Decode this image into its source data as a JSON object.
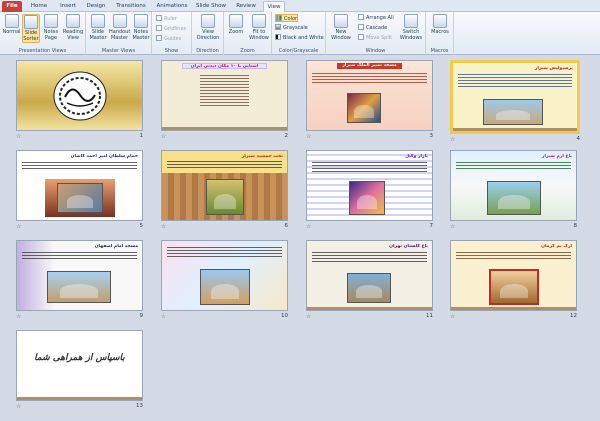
{
  "tabs": [
    "File",
    "Home",
    "Insert",
    "Design",
    "Transitions",
    "Animations",
    "Slide Show",
    "Review",
    "View"
  ],
  "active_tab": "View",
  "ribbon": {
    "presentation_views": {
      "label": "Presentation Views",
      "buttons": [
        "Normal",
        "Slide Sorter",
        "Notes Page",
        "Reading View"
      ]
    },
    "master_views": {
      "label": "Master Views",
      "buttons": [
        "Slide Master",
        "Handout Master",
        "Notes Master"
      ]
    },
    "show": {
      "label": "Show",
      "items": [
        "Ruler",
        "Gridlines",
        "Guides"
      ]
    },
    "direction": {
      "label": "Direction",
      "button": "View Direction"
    },
    "zoom": {
      "label": "Zoom",
      "buttons": [
        "Zoom",
        "Fit to Window"
      ]
    },
    "color_grayscale": {
      "label": "Color/Grayscale",
      "items": [
        "Color",
        "Grayscale",
        "Black and White"
      ]
    },
    "window": {
      "label": "Window",
      "new_window": "New Window",
      "items": [
        "Arrange All",
        "Cascade",
        "Move Split"
      ],
      "switch_windows": "Switch Windows"
    },
    "macros": {
      "label": "Macros",
      "button": "Macros"
    }
  },
  "slides": [
    {
      "number": "1",
      "title": ""
    },
    {
      "number": "2",
      "title": "آشنایی با ۱۰ مکان دیدنی ایران"
    },
    {
      "number": "3",
      "title": "مسجد نصیر الملک شیراز"
    },
    {
      "number": "4",
      "title": "پرسپولیس شیراز"
    },
    {
      "number": "5",
      "title": "حمام سلطان امیر احمد کاشان"
    },
    {
      "number": "6",
      "title": "تخت جمشید شیراز"
    },
    {
      "number": "7",
      "title": "بازار وکیل"
    },
    {
      "number": "8",
      "title": "باغ ارم شیراز"
    },
    {
      "number": "9",
      "title": "مسجد امام اصفهان"
    },
    {
      "number": "10",
      "title": ""
    },
    {
      "number": "11",
      "title": "باغ گلستان تهران"
    },
    {
      "number": "12",
      "title": "ارگ بم کرمان"
    },
    {
      "number": "13",
      "title": "باسپاس از همراهی شما"
    }
  ],
  "colors": {
    "file_tab": "#c5413a",
    "selection": "#f2c94c",
    "sorter_bg": "#d4dbe6"
  }
}
